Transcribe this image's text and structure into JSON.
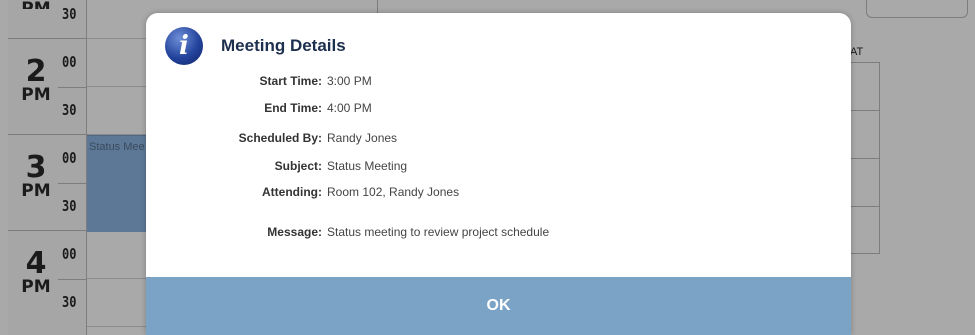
{
  "calendar": {
    "hours": [
      {
        "hour": "",
        "ampm": "PM",
        "min_00": "",
        "min_30": "30"
      },
      {
        "hour": "2",
        "ampm": "PM",
        "min_00": "00",
        "min_30": "30"
      },
      {
        "hour": "3",
        "ampm": "PM",
        "min_00": "00",
        "min_30": "30"
      },
      {
        "hour": "4",
        "ampm": "PM",
        "min_00": "00",
        "min_30": "30"
      }
    ],
    "event_label": "Status Mee",
    "sat_label": "AT"
  },
  "modal": {
    "title": "Meeting Details",
    "icon": "info-icon",
    "icon_glyph": "i",
    "details": [
      {
        "label": "Start Time:",
        "value": "3:00 PM"
      },
      {
        "label": "End Time:",
        "value": "4:00 PM"
      },
      {
        "label": "Scheduled By:",
        "value": "Randy Jones"
      },
      {
        "label": "Subject:",
        "value": "Status Meeting"
      },
      {
        "label": "Attending:",
        "value": "Room 102, Randy Jones"
      },
      {
        "label": "Message:",
        "value": "Status meeting to review project schedule"
      }
    ],
    "ok_label": "OK"
  },
  "colors": {
    "overlay": "#9a9a9a",
    "ok_bar": "#7ba3c6",
    "title": "#1d2f4f",
    "event": "#5d7897"
  }
}
